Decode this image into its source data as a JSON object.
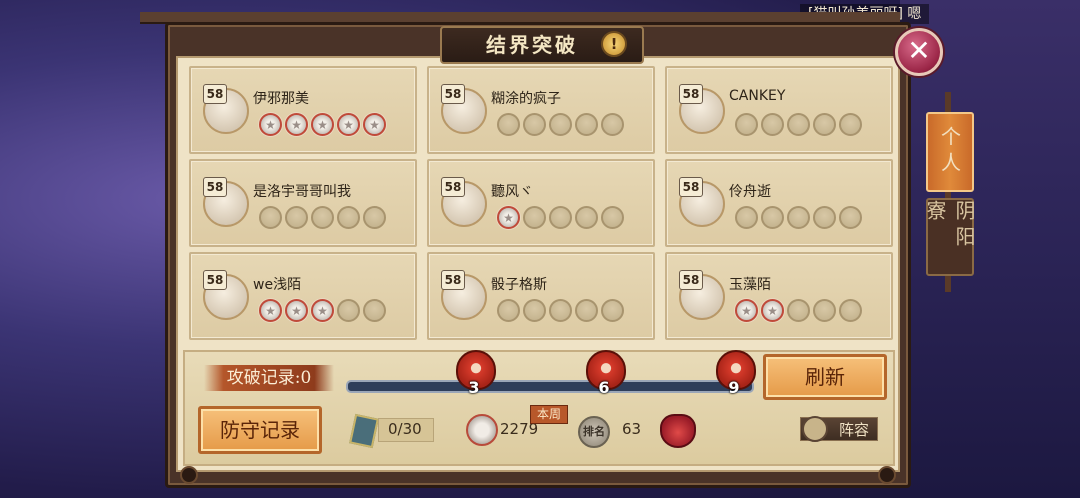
{
  "chat": {
    "text": "[猫叫孙美丽呀] 嗯"
  },
  "title": "结界突破",
  "warn_icon": "!",
  "close_label": "✕",
  "tabs": [
    {
      "label": "个人",
      "active": true
    },
    {
      "label": "阴阳寮",
      "active": false
    }
  ],
  "cards": [
    {
      "level": "58",
      "name": "伊邪那美",
      "broken": 5,
      "total": 5
    },
    {
      "level": "58",
      "name": "糊涂的疯子",
      "broken": 0,
      "total": 5
    },
    {
      "level": "58",
      "name": "CANKEY",
      "broken": 0,
      "total": 5
    },
    {
      "level": "58",
      "name": "是洛宇哥哥叫我",
      "broken": 0,
      "total": 5
    },
    {
      "level": "58",
      "name": "聽风ヾ",
      "broken": 1,
      "total": 5
    },
    {
      "level": "58",
      "name": "伶舟逝",
      "broken": 0,
      "total": 5
    },
    {
      "level": "58",
      "name": "we浅陌",
      "broken": 3,
      "total": 5
    },
    {
      "level": "58",
      "name": "骰子格斯",
      "broken": 0,
      "total": 5
    },
    {
      "level": "58",
      "name": "玉藻陌",
      "broken": 2,
      "total": 5
    }
  ],
  "record": {
    "label": "攻破记录:0",
    "progress": 0
  },
  "milestones": [
    "3",
    "6",
    "9"
  ],
  "buttons": {
    "refresh": "刷新",
    "defense": "防守记录",
    "lineup": "阵容"
  },
  "stats": {
    "tickets": "0/30",
    "score": "2279",
    "weekly_tag": "本周",
    "rank_icon_label": "排名",
    "rank": "63"
  },
  "colors": {
    "accent": "#e59a48",
    "slot_broken_ring": "#c04a3a",
    "frame": "#4a3328"
  }
}
